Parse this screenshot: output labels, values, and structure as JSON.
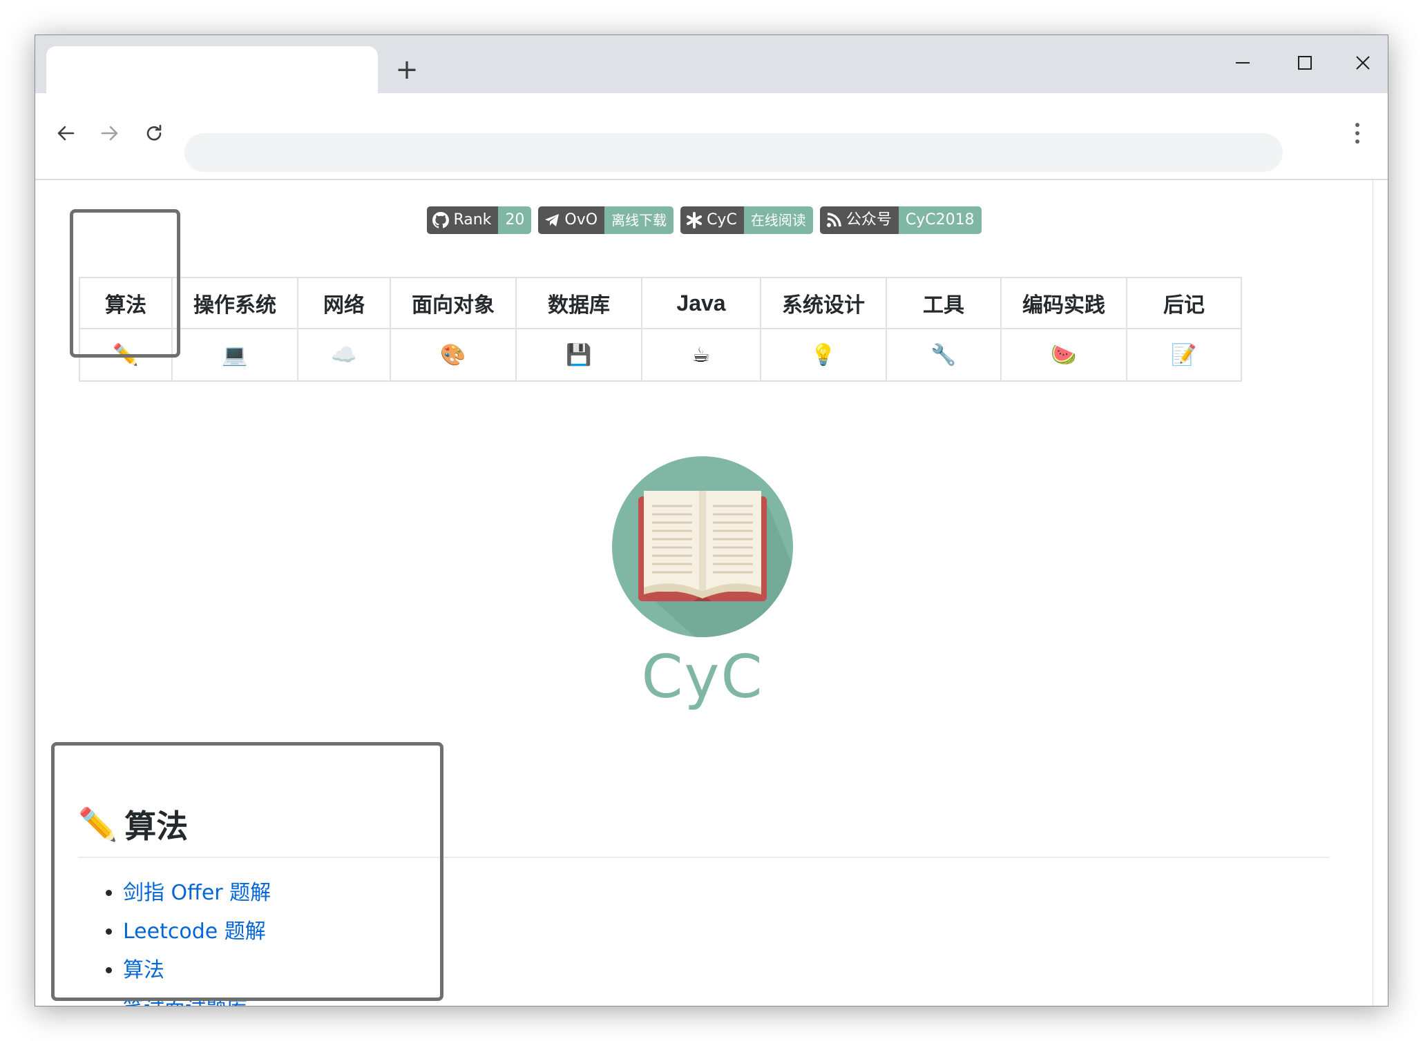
{
  "browser": {
    "new_tab_label": "+",
    "address": ""
  },
  "badges": [
    {
      "icon": "github-icon",
      "label": "Rank",
      "value": "20"
    },
    {
      "icon": "telegram-icon",
      "label": "OvO",
      "value": "离线下载"
    },
    {
      "icon": "asterisk-icon",
      "label": "CyC",
      "value": "在线阅读"
    },
    {
      "icon": "rss-icon",
      "label": "公众号",
      "value": "CyC2018"
    }
  ],
  "nav": [
    {
      "label": "算法",
      "icon": "pencil-icon",
      "glyph": "✏️"
    },
    {
      "label": "操作系统",
      "icon": "laptop-icon",
      "glyph": "💻"
    },
    {
      "label": "网络",
      "icon": "cloud-icon",
      "glyph": "☁️"
    },
    {
      "label": "面向对象",
      "icon": "palette-icon",
      "glyph": "🎨"
    },
    {
      "label": "数据库",
      "icon": "floppy-disk-icon",
      "glyph": "💾"
    },
    {
      "label": "Java",
      "icon": "coffee-icon",
      "glyph": "☕"
    },
    {
      "label": "系统设计",
      "icon": "lightbulb-icon",
      "glyph": "💡"
    },
    {
      "label": "工具",
      "icon": "wrench-icon",
      "glyph": "🔧"
    },
    {
      "label": "编码实践",
      "icon": "watermelon-icon",
      "glyph": "🍉"
    },
    {
      "label": "后记",
      "icon": "memo-icon",
      "glyph": "📝"
    }
  ],
  "logo": {
    "text": "CyC",
    "circle_color": "#7fb7a4"
  },
  "section": {
    "icon_glyph": "✏️",
    "title": "算法",
    "links": [
      "剑指 Offer 题解",
      "Leetcode 题解",
      "算法",
      "笔试面试题库"
    ]
  },
  "colors": {
    "accent": "#7fb7a4",
    "link": "#0366d6",
    "badge_dark": "#555555"
  }
}
